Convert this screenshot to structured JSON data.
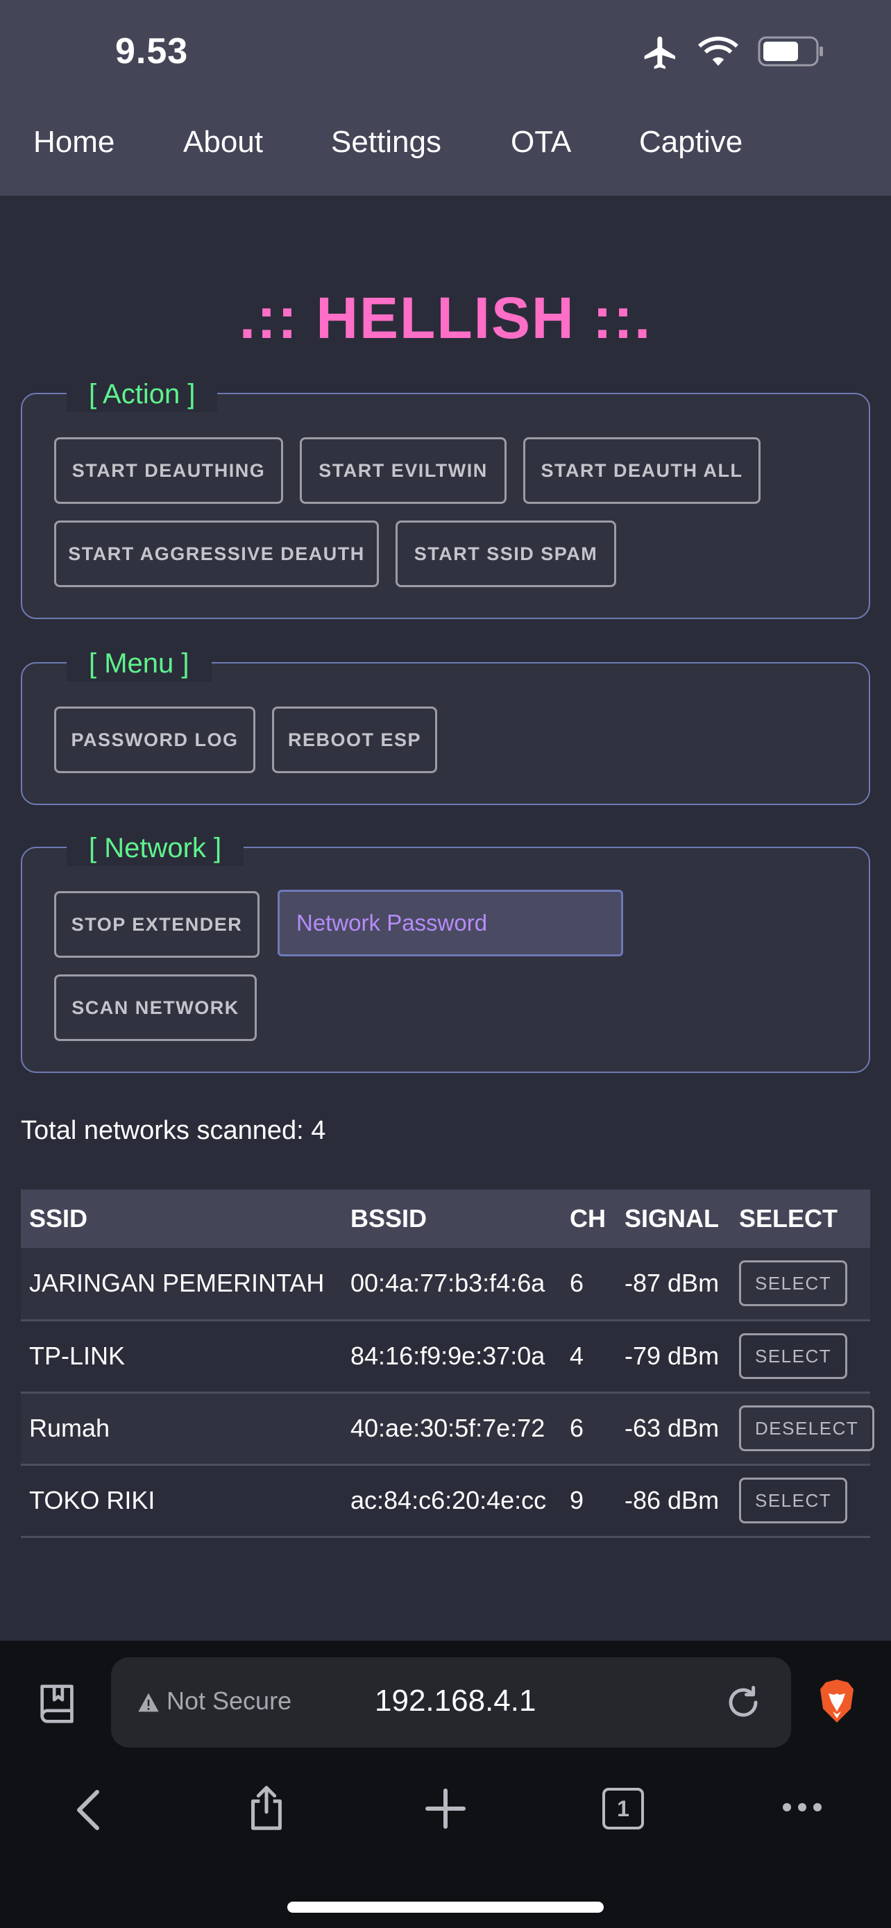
{
  "status_bar": {
    "time": "9.53",
    "icons": [
      "airplane-icon",
      "wifi-icon",
      "battery-icon"
    ]
  },
  "nav": {
    "items": [
      {
        "label": "Home"
      },
      {
        "label": "About"
      },
      {
        "label": "Settings"
      },
      {
        "label": "OTA"
      },
      {
        "label": "Captive"
      }
    ]
  },
  "page": {
    "title": ".:: HELLISH ::.",
    "title_color": "#ff6ec7",
    "legend_color": "#5ef38c"
  },
  "action_panel": {
    "legend": "[ Action ]",
    "buttons": [
      {
        "label": "START DEAUTHING"
      },
      {
        "label": "START EVILTWIN"
      },
      {
        "label": "START DEAUTH ALL"
      },
      {
        "label": "START AGGRESSIVE DEAUTH"
      },
      {
        "label": "START SSID SPAM"
      }
    ]
  },
  "menu_panel": {
    "legend": "[ Menu ]",
    "buttons": [
      {
        "label": "PASSWORD LOG"
      },
      {
        "label": "REBOOT ESP"
      }
    ]
  },
  "network_panel": {
    "legend": "[ Network ]",
    "stop_extender_label": "STOP EXTENDER",
    "password_placeholder": "Network Password",
    "scan_label": "SCAN NETWORK"
  },
  "scan": {
    "total_text": "Total networks scanned: 4",
    "columns": [
      "SSID",
      "BSSID",
      "CH",
      "SIGNAL",
      "SELECT"
    ],
    "rows": [
      {
        "ssid": "JARINGAN PEMERINTAH",
        "bssid": "00:4a:77:b3:f4:6a",
        "ch": "6",
        "signal": "-87 dBm",
        "action": "SELECT"
      },
      {
        "ssid": "TP-LINK",
        "bssid": "84:16:f9:9e:37:0a",
        "ch": "4",
        "signal": "-79 dBm",
        "action": "SELECT"
      },
      {
        "ssid": "Rumah",
        "bssid": "40:ae:30:5f:7e:72",
        "ch": "6",
        "signal": "-63 dBm",
        "action": "DESELECT"
      },
      {
        "ssid": "TOKO RIKI",
        "bssid": "ac:84:c6:20:4e:cc",
        "ch": "9",
        "signal": "-86 dBm",
        "action": "SELECT"
      }
    ]
  },
  "browser": {
    "security_label": "Not Secure",
    "url": "192.168.4.1",
    "toolbar_icons": [
      "back-icon",
      "share-icon",
      "new-tab-icon",
      "tabs-icon",
      "more-icon"
    ],
    "tab_count": "1"
  }
}
